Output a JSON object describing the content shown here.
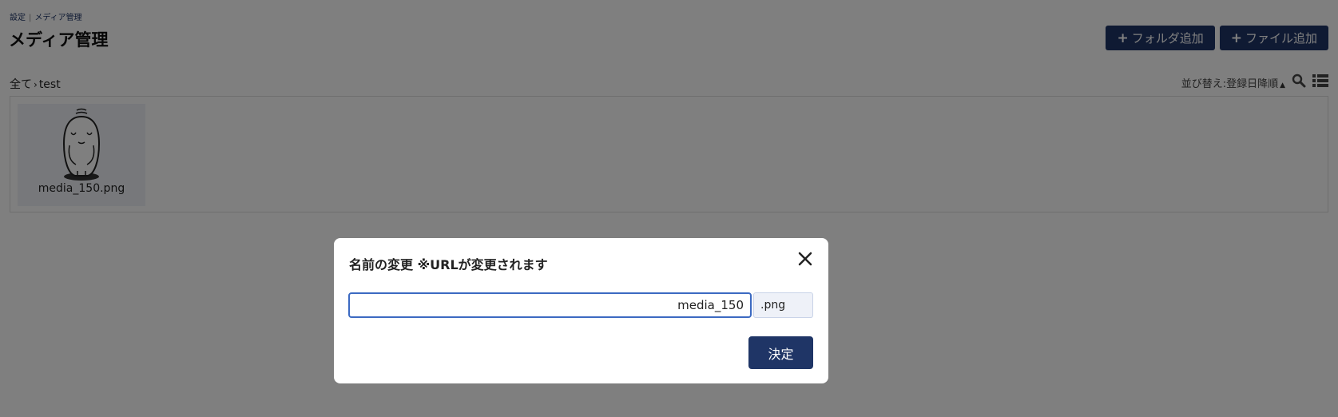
{
  "breadcrumb": {
    "parent": "設定",
    "current": "メディア管理"
  },
  "page_title": "メディア管理",
  "actions": {
    "add_folder": "フォルダ追加",
    "add_file": "ファイル追加"
  },
  "folder_path": {
    "root": "全て",
    "current": "test"
  },
  "list_controls": {
    "sort_label": "並び替え:登録日降順"
  },
  "files": [
    {
      "name": "media_150.png"
    }
  ],
  "modal": {
    "title": "名前の変更 ※URLが変更されます",
    "input_value": "media_150",
    "extension": ".png",
    "confirm_label": "決定"
  },
  "colors": {
    "accent": "#1f3566",
    "focus": "#3c6ac2"
  }
}
